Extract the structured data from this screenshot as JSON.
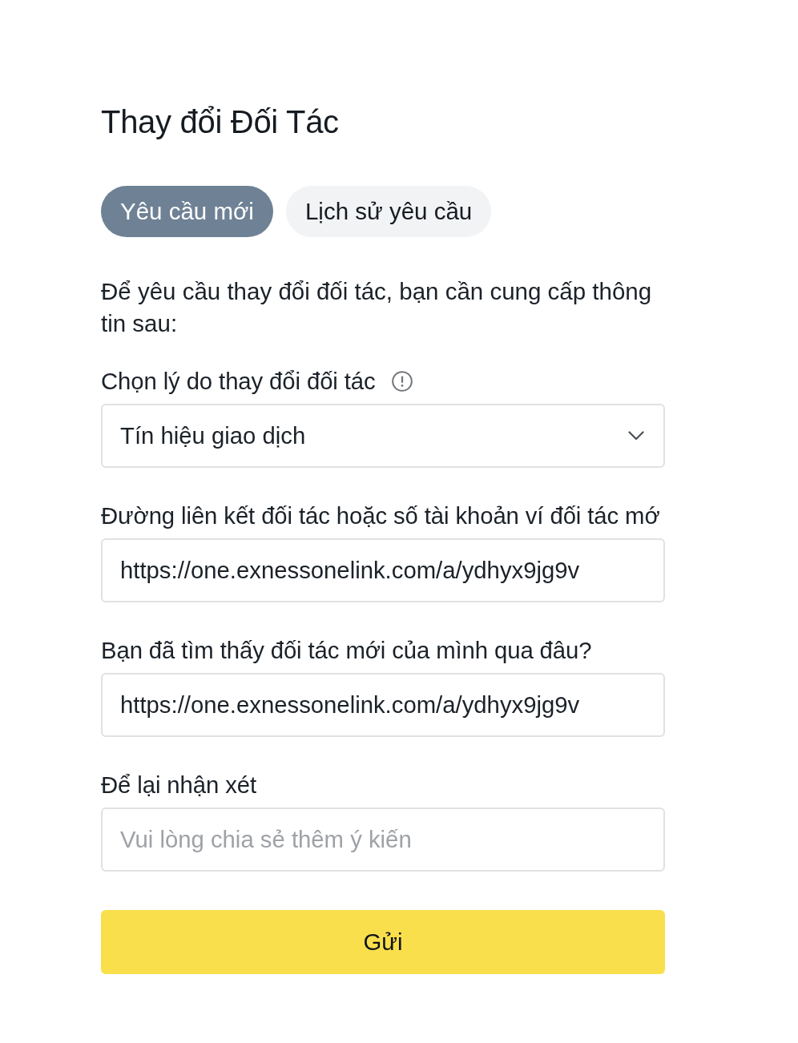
{
  "title": "Thay đổi Đối Tác",
  "tabs": [
    {
      "label": "Yêu cầu mới",
      "selected": true
    },
    {
      "label": "Lịch sử yêu cầu",
      "selected": false
    }
  ],
  "intro": "Để yêu cầu thay đổi đối tác, bạn cần cung cấp thông tin sau:",
  "fields": [
    {
      "kind": "select",
      "label": "Chọn lý do thay đổi đối tác",
      "info": true,
      "value": "Tín hiệu giao dịch"
    },
    {
      "kind": "text",
      "label": "Đường liên kết đối tác hoặc số tài khoản ví đối tác mớ",
      "info": false,
      "value": "https://one.exnessonelink.com/a/ydhyx9jg9v"
    },
    {
      "kind": "text",
      "label": "Bạn đã tìm thấy đối tác mới của mình qua đâu?",
      "info": false,
      "value": "https://one.exnessonelink.com/a/ydhyx9jg9v"
    },
    {
      "kind": "text",
      "label": "Để lại nhận xét",
      "info": false,
      "placeholder": "Vui lòng chia sẻ thêm ý kiến"
    }
  ],
  "submit": {
    "label": "Gửi"
  }
}
